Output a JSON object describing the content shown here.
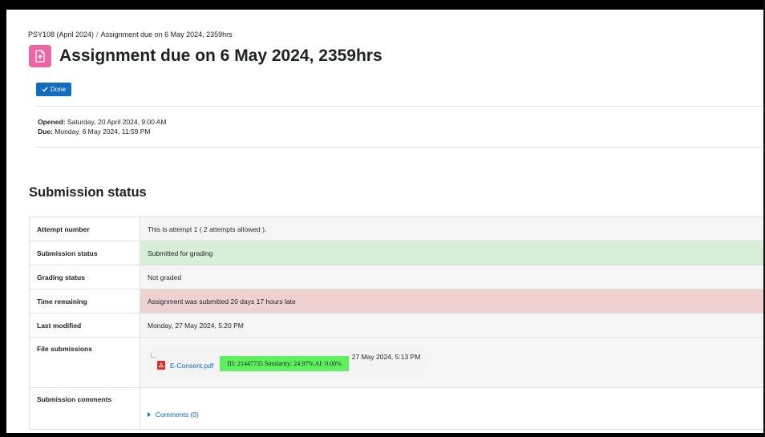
{
  "breadcrumb": {
    "course": "PSY108 (April 2024)",
    "separator": "/",
    "current": "Assignment due on 6 May 2024, 2359hrs"
  },
  "header": {
    "title": "Assignment due on 6 May 2024, 2359hrs",
    "icon": "assignment-icon",
    "icon_color": "#eb66a2"
  },
  "completion": {
    "done_label": "Done",
    "done_color": "#0f6cbf"
  },
  "dates": {
    "opened_label": "Opened:",
    "opened_value": "Saturday, 20 April 2024, 9:00 AM",
    "due_label": "Due:",
    "due_value": "Monday, 6 May 2024, 11:59 PM"
  },
  "submission": {
    "heading": "Submission status",
    "rows": [
      {
        "label": "Attempt number",
        "value": "This is attempt 1 ( 2 attempts allowed )."
      },
      {
        "label": "Submission status",
        "value": "Submitted for grading"
      },
      {
        "label": "Grading status",
        "value": "Not graded"
      },
      {
        "label": "Time remaining",
        "value": "Assignment was submitted 20 days 17 hours late"
      },
      {
        "label": "Last modified",
        "value": "Monday, 27 May 2024, 5:20 PM"
      },
      {
        "label": "File submissions"
      },
      {
        "label": "Submission comments"
      }
    ],
    "file": {
      "name": "E-Consent.pdf",
      "similarity": "ID: 21447735 Similarity: 24.97% AI: 0.00%",
      "date": "27 May 2024, 5:13 PM"
    },
    "comments_link": "Comments (0)",
    "colors": {
      "submitted": "#d7eed7",
      "late": "#efd1d1",
      "similarity_badge": "#5ef05e"
    }
  }
}
